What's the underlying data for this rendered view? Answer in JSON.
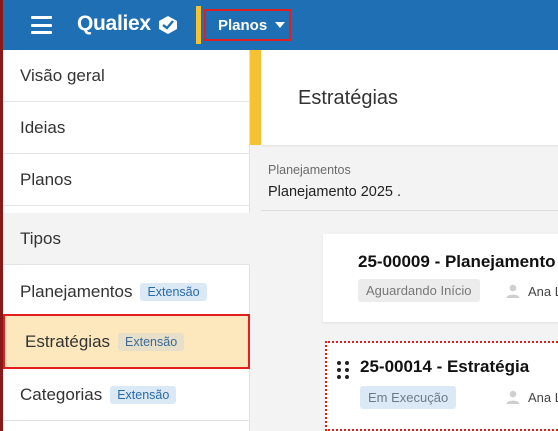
{
  "topbar": {
    "logo_text": "Qualiex",
    "menu_button": "Planos"
  },
  "sidebar": {
    "items": [
      {
        "label": "Visão geral",
        "badge": ""
      },
      {
        "label": "Ideias",
        "badge": ""
      },
      {
        "label": "Planos",
        "badge": ""
      },
      {
        "label": "Tipos",
        "badge": ""
      },
      {
        "label": "Planejamentos",
        "badge": "Extensão"
      },
      {
        "label": "Estratégias",
        "badge": "Extensão"
      },
      {
        "label": "Categorias",
        "badge": "Extensão"
      }
    ]
  },
  "main": {
    "title": "Estratégias",
    "field_label": "Planejamentos",
    "field_value": "Planejamento 2025 ."
  },
  "cards": [
    {
      "title": "25-00009 - Planejamento",
      "status": "Aguardando Início",
      "owner": "Ana L"
    },
    {
      "title": "25-00014 - Estratégia",
      "status": "Em Execução",
      "owner": "Ana L"
    }
  ],
  "colors": {
    "topbar": "#1f6fb4",
    "accent_yellow": "#f5c232",
    "highlight_red": "#e02020",
    "active_item": "#fde8bd"
  },
  "icons": [
    "menu-icon",
    "qualiex-logo-mark",
    "caret-down-icon",
    "person-icon",
    "drag-handle-icon"
  ]
}
